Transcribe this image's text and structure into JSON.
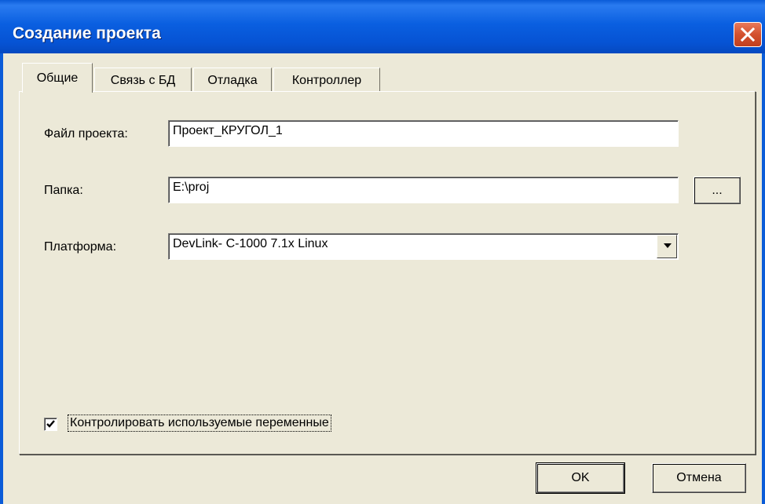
{
  "window": {
    "title": "Создание проекта"
  },
  "tabs": [
    {
      "label": "Общие",
      "active": true
    },
    {
      "label": "Связь с БД",
      "active": false
    },
    {
      "label": "Отладка",
      "active": false
    },
    {
      "label": "Контроллер",
      "active": false
    }
  ],
  "general": {
    "project_file_label": "Файл проекта:",
    "project_file_value": "Проект_КРУГОЛ_1",
    "folder_label": "Папка:",
    "folder_value": "E:\\proj",
    "browse_label": "...",
    "platform_label": "Платформа:",
    "platform_value": "DevLink- C-1000 7.1x Linux",
    "check_vars_label": "Контролировать используемые переменные",
    "check_vars_checked": true
  },
  "buttons": {
    "ok_label": "OK",
    "cancel_label": "Отмена"
  },
  "icons": {
    "close": "close-icon",
    "dropdown": "chevron-down-icon",
    "check": "checkmark-icon"
  },
  "colors": {
    "titlebar": "#0a5fe0",
    "close_button": "#d3512e",
    "dialog_bg": "#ece9d8"
  }
}
